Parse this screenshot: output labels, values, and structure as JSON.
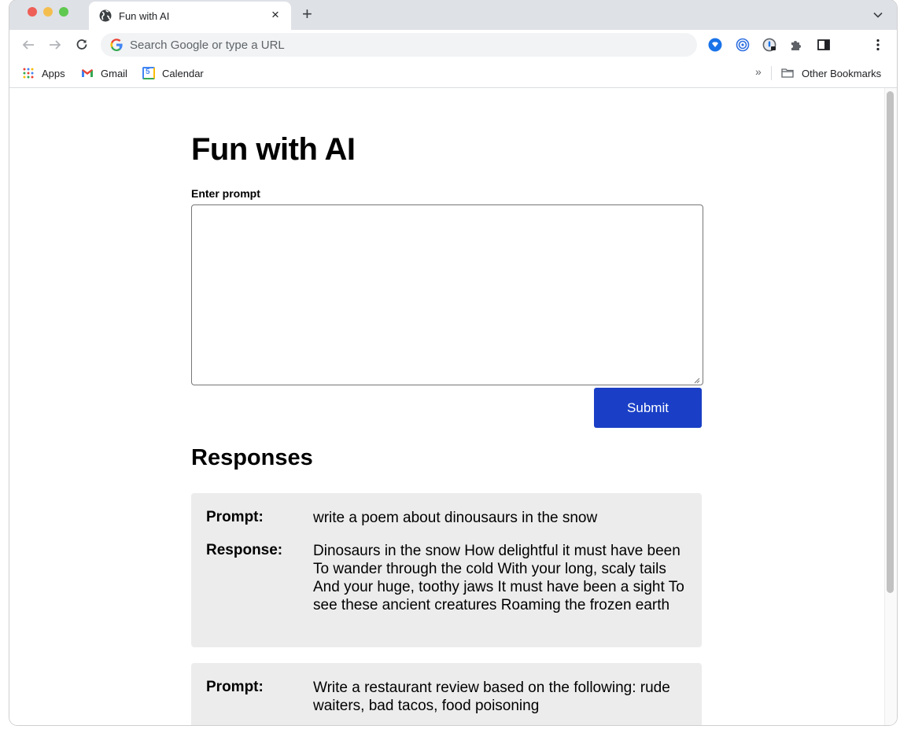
{
  "browser": {
    "tab": {
      "title": "Fun with AI",
      "close_glyph": "×"
    },
    "new_tab_glyph": "+",
    "omnibox": {
      "placeholder": "Search Google or type a URL"
    },
    "bookmarks": [
      {
        "label": "Apps",
        "icon": "apps-grid-icon"
      },
      {
        "label": "Gmail",
        "icon": "gmail-icon"
      },
      {
        "label": "Calendar",
        "icon": "calendar-icon"
      }
    ],
    "bookmarks_overflow_glyph": "»",
    "other_bookmarks": "Other Bookmarks",
    "calendar_day": "5"
  },
  "page": {
    "title": "Fun with AI",
    "prompt_label": "Enter prompt",
    "prompt_value": "",
    "submit_label": "Submit",
    "responses_heading": "Responses",
    "prompt_key": "Prompt:",
    "response_key": "Response:",
    "responses": [
      {
        "prompt": "write a poem about dinousaurs in the snow",
        "response": "Dinosaurs in the snow How delightful it must have been To wander through the cold With your long, scaly tails And your huge, toothy jaws It must have been a sight To see these ancient creatures Roaming the frozen earth"
      },
      {
        "prompt": "Write a restaurant review based on the following: rude waiters, bad tacos, food poisoning",
        "response": ""
      }
    ]
  },
  "colors": {
    "submit_button": "#1a3fc6",
    "card_background": "#ececec",
    "tabstrip": "#dee1e6"
  }
}
